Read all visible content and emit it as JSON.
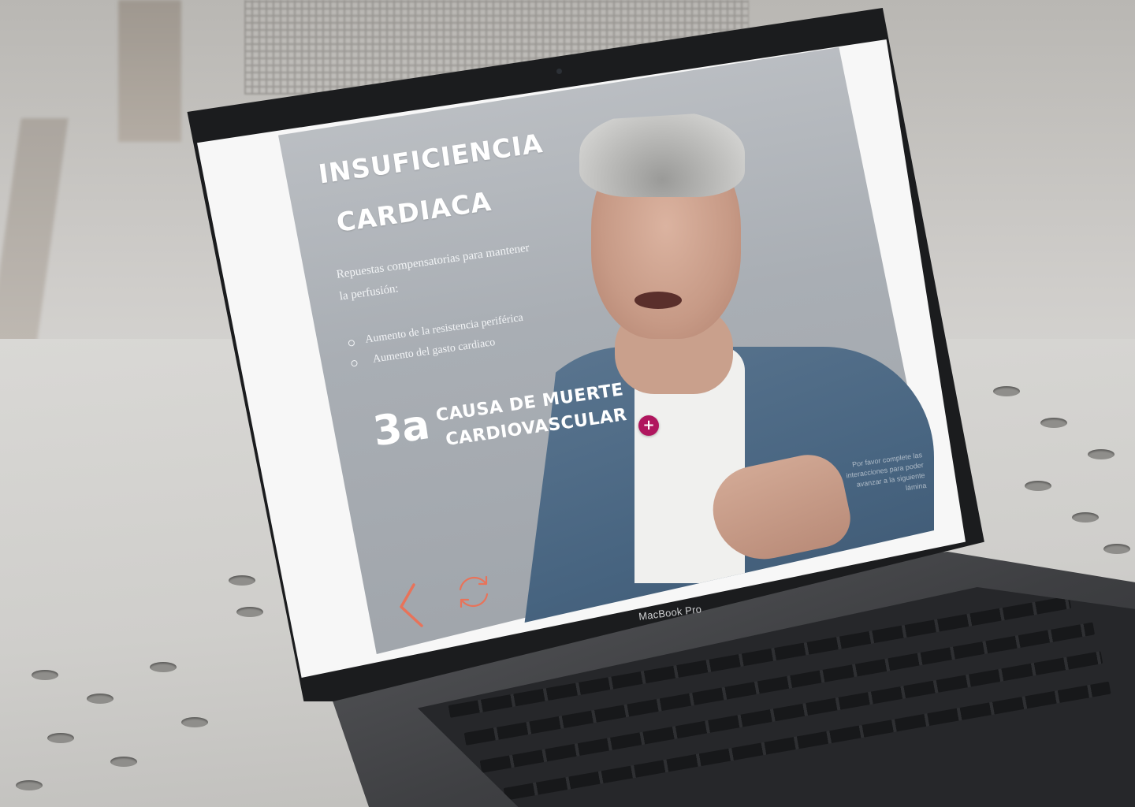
{
  "device": {
    "brand_label": "MacBook Pro"
  },
  "slide": {
    "title_line1": "INSUFICIENCIA",
    "title_line2": "CARDIACA",
    "intro": "Repuestas compensatorias para mantener la perfusión:",
    "bullets": [
      "Aumento de la resistencia periférica",
      "Aumento del gasto cardiaco"
    ],
    "stat": {
      "number": "3a",
      "label_line1": "CAUSA DE MUERTE",
      "label_line2": "CARDIOVASCULAR"
    },
    "plus_symbol": "+",
    "hint": "Por favor complete las interacciones para poder avanzar a la siguiente lámina"
  },
  "navigation": {
    "prev_icon": "chevron-left-icon",
    "reload_icon": "reload-icon"
  },
  "colors": {
    "accent": "#b0165e",
    "nav": "#e8735a",
    "text": "#ffffff"
  }
}
